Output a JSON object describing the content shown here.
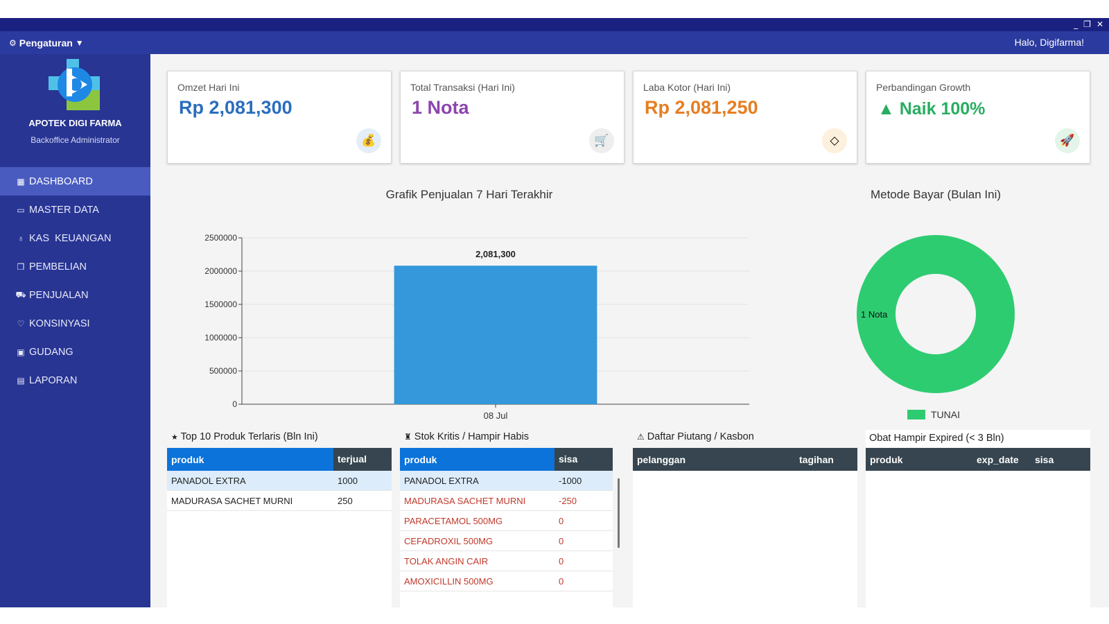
{
  "window": {
    "minimize": "_",
    "restore": "❐",
    "close": "✕"
  },
  "topbar": {
    "settings_icon": "⚙",
    "settings_label": "Pengaturan",
    "settings_caret": "▼",
    "greeting": "Halo, Digifarma!"
  },
  "sidebar": {
    "brand": "APOTEK DIGI FARMA",
    "subtitle": "Backoffice Administrator",
    "items": [
      {
        "icon": "▦",
        "label": "DASHBOARD",
        "active": true
      },
      {
        "icon": "▭",
        "label": "MASTER DATA"
      },
      {
        "icon": "♁",
        "label": "KAS  KEUANGAN"
      },
      {
        "icon": "❒",
        "label": "PEMBELIAN"
      },
      {
        "icon": "⛟",
        "label": "PENJUALAN"
      },
      {
        "icon": "♡",
        "label": "KONSINYASI"
      },
      {
        "icon": "▣",
        "label": "GUDANG"
      },
      {
        "icon": "▤",
        "label": "LAPORAN"
      }
    ]
  },
  "cards": [
    {
      "label": "Omzet Hari Ini",
      "value": "Rp 2,081,300",
      "color": "#2a6ebd",
      "icon": "money-bag-icon",
      "glyph": "💰",
      "icon_bg": "#e3eefa"
    },
    {
      "label": "Total Transaksi (Hari Ini)",
      "value": "1 Nota",
      "color": "#8e44ad",
      "icon": "cart-icon",
      "glyph": "🛒",
      "icon_bg": "#eeeeee"
    },
    {
      "label": "Laba Kotor (Hari Ini)",
      "value": "Rp 2,081,250",
      "color": "#e67e22",
      "icon": "diamond-icon",
      "glyph": "◇",
      "icon_bg": "#fdf0dc"
    },
    {
      "label": "Perbandingan Growth",
      "value": "▲ Naik 100%",
      "color": "#27ae60",
      "icon": "rocket-icon",
      "glyph": "🚀",
      "icon_bg": "#e3f5e9"
    }
  ],
  "bar_title": "Grafik Penjualan 7 Hari Terakhir",
  "donut_title": "Metode Bayar (Bulan Ini)",
  "chart_data": [
    {
      "type": "bar",
      "title": "Grafik Penjualan 7 Hari Terakhir",
      "categories": [
        "08 Jul"
      ],
      "values": [
        2081300
      ],
      "value_labels": [
        "2,081,300"
      ],
      "y_ticks": [
        0,
        500000,
        1000000,
        1500000,
        2000000,
        2500000
      ],
      "ylim": [
        0,
        2500000
      ],
      "grid": true,
      "color": "#3498db"
    },
    {
      "type": "pie",
      "title": "Metode Bayar (Bulan Ini)",
      "labels": [
        "TUNAI"
      ],
      "values": [
        1
      ],
      "slice_labels": [
        "1 Nota"
      ],
      "color": "#2ecc71",
      "legend": "bottom"
    }
  ],
  "panels": {
    "top_products": {
      "icon": "★",
      "title": "Top 10 Produk Terlaris (Bln Ini)",
      "headers": [
        "produk",
        "terjual"
      ],
      "rows": [
        [
          "PANADOL EXTRA",
          "1000"
        ],
        [
          "MADURASA SACHET MURNI",
          "250"
        ]
      ]
    },
    "critical_stock": {
      "icon": "♜",
      "title": "Stok Kritis / Hampir Habis",
      "headers": [
        "produk",
        "sisa"
      ],
      "rows": [
        [
          "PANADOL EXTRA",
          "-1000"
        ],
        [
          "MADURASA SACHET MURNI",
          "-250"
        ],
        [
          "PARACETAMOL 500MG",
          "0"
        ],
        [
          "CEFADROXIL 500MG",
          "0"
        ],
        [
          "TOLAK ANGIN CAIR",
          "0"
        ],
        [
          "AMOXICILLIN 500MG",
          "0"
        ]
      ]
    },
    "receivables": {
      "icon": "⚠",
      "title": "Daftar Piutang / Kasbon",
      "headers": [
        "pelanggan",
        "tagihan"
      ]
    },
    "expiring": {
      "title": "Obat Hampir Expired (< 3 Bln)",
      "headers": [
        "produk",
        "exp_date",
        "sisa"
      ]
    }
  }
}
